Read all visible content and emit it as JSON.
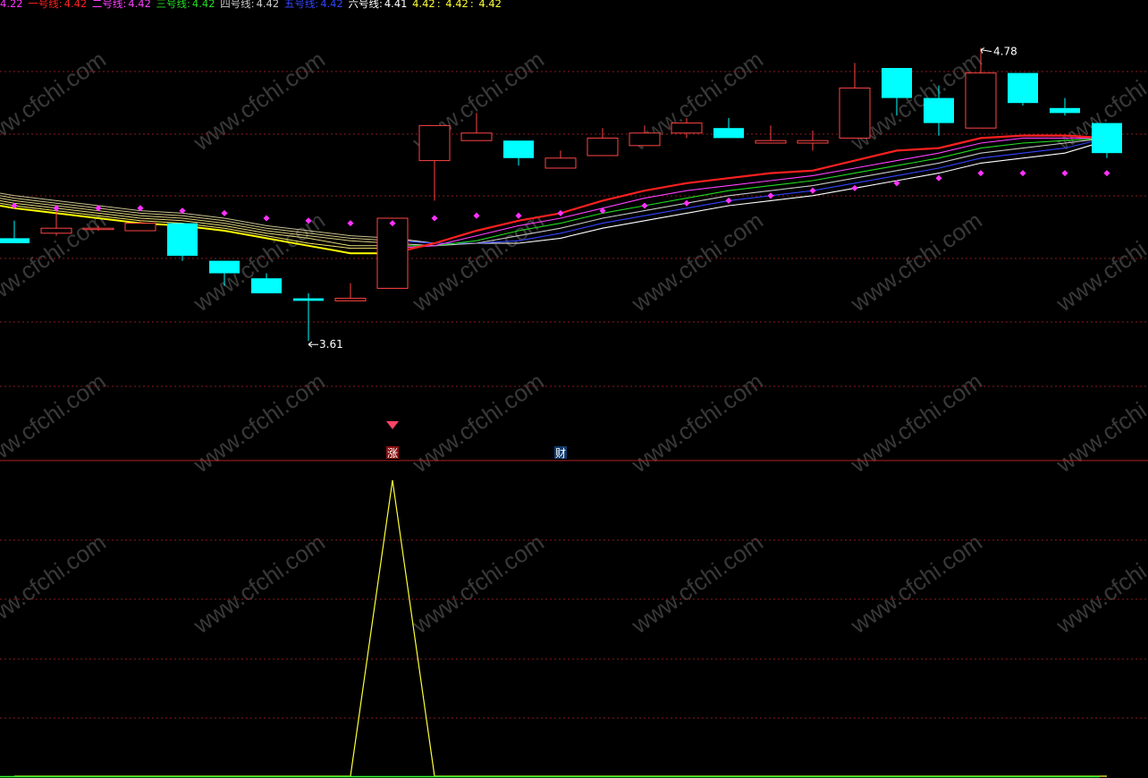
{
  "legend": {
    "first_value": "4.22",
    "first_color": "#ff33ff",
    "items": [
      {
        "label": "一号线:",
        "value": "4.42",
        "color": "#ff2020"
      },
      {
        "label": "二号线:",
        "value": "4.42",
        "color": "#ff40ff"
      },
      {
        "label": "三号线:",
        "value": "4.42",
        "color": "#22dd22"
      },
      {
        "label": "四号线:",
        "value": "4.42",
        "color": "#c8c8c8"
      },
      {
        "label": "五号线:",
        "value": "4.42",
        "color": "#3344ff"
      },
      {
        "label": "六号线:",
        "value": "4.41",
        "color": "#ffffff"
      }
    ],
    "tail_values": [
      "4.42",
      "4.42",
      "4.42"
    ],
    "tail_color": "#ffff33"
  },
  "markers": {
    "zhang": "涨",
    "cai": "财"
  },
  "colors": {
    "up": "#ff4444",
    "down": "#00ffff",
    "dot": "#ff33ff",
    "grid": "#8b1a1a",
    "separator": "#b22222",
    "indicator": "#ffff33",
    "baseline": "#33ff33",
    "watermark": "#ffffff"
  },
  "watermark": "www.cfchi.com",
  "chart_data": {
    "type": "candlestick",
    "ylim": [
      3.4,
      4.9
    ],
    "candles": [
      {
        "open": 4.02,
        "high": 4.09,
        "low": 4.0,
        "close": 4.0
      },
      {
        "open": 4.04,
        "high": 4.14,
        "low": 4.03,
        "close": 4.06
      },
      {
        "open": 4.06,
        "high": 4.07,
        "low": 4.05,
        "close": 4.06
      },
      {
        "open": 4.05,
        "high": 4.09,
        "low": 4.05,
        "close": 4.08
      },
      {
        "open": 4.08,
        "high": 4.08,
        "low": 3.93,
        "close": 3.95
      },
      {
        "open": 3.93,
        "high": 3.93,
        "low": 3.83,
        "close": 3.88
      },
      {
        "open": 3.86,
        "high": 3.88,
        "low": 3.8,
        "close": 3.8
      },
      {
        "open": 3.78,
        "high": 3.8,
        "low": 3.61,
        "close": 3.77
      },
      {
        "open": 3.77,
        "high": 3.84,
        "low": 3.77,
        "close": 3.78
      },
      {
        "open": 3.82,
        "high": 4.1,
        "low": 3.82,
        "close": 4.1
      },
      {
        "open": 4.33,
        "high": 4.39,
        "low": 4.17,
        "close": 4.47
      },
      {
        "open": 4.41,
        "high": 4.52,
        "low": 4.41,
        "close": 4.44
      },
      {
        "open": 4.41,
        "high": 4.41,
        "low": 4.31,
        "close": 4.34
      },
      {
        "open": 4.3,
        "high": 4.37,
        "low": 4.3,
        "close": 4.34
      },
      {
        "open": 4.35,
        "high": 4.46,
        "low": 4.35,
        "close": 4.42
      },
      {
        "open": 4.39,
        "high": 4.47,
        "low": 4.39,
        "close": 4.44
      },
      {
        "open": 4.44,
        "high": 4.5,
        "low": 4.42,
        "close": 4.48
      },
      {
        "open": 4.46,
        "high": 4.5,
        "low": 4.42,
        "close": 4.42
      },
      {
        "open": 4.4,
        "high": 4.47,
        "low": 4.4,
        "close": 4.41
      },
      {
        "open": 4.4,
        "high": 4.45,
        "low": 4.37,
        "close": 4.41
      },
      {
        "open": 4.42,
        "high": 4.72,
        "low": 4.42,
        "close": 4.62
      },
      {
        "open": 4.7,
        "high": 4.7,
        "low": 4.51,
        "close": 4.58
      },
      {
        "open": 4.58,
        "high": 4.63,
        "low": 4.43,
        "close": 4.48
      },
      {
        "open": 4.46,
        "high": 4.78,
        "low": 4.46,
        "close": 4.68
      },
      {
        "open": 4.68,
        "high": 4.68,
        "low": 4.55,
        "close": 4.56
      },
      {
        "open": 4.54,
        "high": 4.58,
        "low": 4.51,
        "close": 4.52
      },
      {
        "open": 4.48,
        "high": 4.48,
        "low": 4.34,
        "close": 4.36
      }
    ],
    "dots": [
      4.15,
      4.14,
      4.14,
      4.14,
      4.13,
      4.12,
      4.1,
      4.09,
      4.08,
      4.08,
      4.1,
      4.11,
      4.11,
      4.12,
      4.13,
      4.15,
      4.16,
      4.17,
      4.19,
      4.21,
      4.22,
      4.24,
      4.26,
      4.28,
      4.28,
      4.28,
      4.28
    ],
    "lines": [
      {
        "name": "一号线",
        "color": "#ff2020",
        "values": [
          4.14,
          4.12,
          4.1,
          4.08,
          4.07,
          4.05,
          4.02,
          3.99,
          3.96,
          3.96,
          4.0,
          4.05,
          4.09,
          4.12,
          4.17,
          4.21,
          4.24,
          4.26,
          4.28,
          4.29,
          4.33,
          4.37,
          4.38,
          4.42,
          4.43,
          4.43,
          4.42
        ]
      },
      {
        "name": "二号线",
        "color": "#ff40ff",
        "values": [
          4.15,
          4.13,
          4.11,
          4.09,
          4.08,
          4.06,
          4.03,
          4.0,
          3.98,
          3.98,
          3.99,
          4.03,
          4.07,
          4.1,
          4.14,
          4.18,
          4.21,
          4.23,
          4.25,
          4.27,
          4.3,
          4.33,
          4.36,
          4.4,
          4.42,
          4.42,
          4.42
        ]
      },
      {
        "name": "三号线",
        "color": "#22dd22",
        "values": [
          4.16,
          4.14,
          4.12,
          4.1,
          4.09,
          4.07,
          4.04,
          4.02,
          3.99,
          3.99,
          3.99,
          4.01,
          4.05,
          4.08,
          4.12,
          4.15,
          4.18,
          4.21,
          4.23,
          4.25,
          4.28,
          4.31,
          4.34,
          4.38,
          4.4,
          4.41,
          4.42
        ]
      },
      {
        "name": "四号线",
        "color": "#c8c8c8",
        "values": [
          4.17,
          4.15,
          4.13,
          4.11,
          4.1,
          4.08,
          4.05,
          4.03,
          4.01,
          4.0,
          3.99,
          4.0,
          4.03,
          4.06,
          4.1,
          4.13,
          4.16,
          4.19,
          4.21,
          4.23,
          4.26,
          4.29,
          4.32,
          4.36,
          4.38,
          4.4,
          4.42
        ]
      },
      {
        "name": "五号线",
        "color": "#3344ff",
        "values": [
          4.18,
          4.16,
          4.14,
          4.12,
          4.11,
          4.09,
          4.06,
          4.04,
          4.02,
          4.01,
          4.0,
          4.0,
          4.01,
          4.04,
          4.08,
          4.11,
          4.14,
          4.17,
          4.19,
          4.21,
          4.24,
          4.27,
          4.3,
          4.34,
          4.36,
          4.38,
          4.42
        ]
      },
      {
        "name": "六号线",
        "color": "#ffffff",
        "values": [
          4.19,
          4.17,
          4.15,
          4.13,
          4.12,
          4.1,
          4.07,
          4.05,
          4.03,
          4.02,
          4.0,
          4.0,
          4.0,
          4.02,
          4.06,
          4.09,
          4.12,
          4.15,
          4.17,
          4.19,
          4.22,
          4.25,
          4.28,
          4.32,
          4.34,
          4.36,
          4.41
        ]
      }
    ],
    "high_label": {
      "index": 23,
      "value": 4.78,
      "text": "4.78"
    },
    "low_label": {
      "index": 7,
      "value": 3.61,
      "text": "3.61"
    },
    "signal_index": 9,
    "cai_index": 13,
    "indicator": {
      "values": [
        0,
        0,
        0,
        0,
        0,
        0,
        0,
        0,
        0,
        1,
        0,
        0,
        0,
        0,
        0,
        0,
        0,
        0,
        0,
        0,
        0,
        0,
        0,
        0,
        0,
        0,
        0
      ],
      "ylim": [
        0,
        1
      ]
    }
  }
}
